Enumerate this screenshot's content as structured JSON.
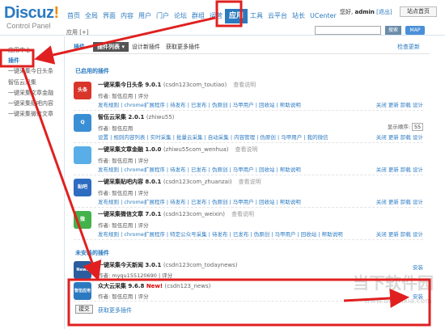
{
  "header": {
    "logo_main": "Discuz",
    "logo_exclaim": "!",
    "logo_sub": "Control Panel",
    "nav": [
      "首页",
      "全局",
      "界面",
      "内容",
      "用户",
      "门户",
      "论坛",
      "群组",
      "运营",
      "应用",
      "工具",
      "云平台",
      "站长",
      "UCenter"
    ],
    "nav_active": "应用",
    "user_greeting": "您好,",
    "user_name": "admin",
    "logout": "[退出]",
    "site_home": "站点首页",
    "breadcrumb": "应用 [+]",
    "search_button": "搜索",
    "map_button": "MAP"
  },
  "sidebar": {
    "items": [
      {
        "label": "应用中心",
        "current": false
      },
      {
        "label": "插件",
        "current": true
      },
      {
        "label": "一键采集今日头条",
        "current": false
      },
      {
        "label": "智伍云采集",
        "current": false
      },
      {
        "label": "一键采集文章金融",
        "current": false
      },
      {
        "label": "一键采集贴吧内容",
        "current": false
      },
      {
        "label": "一键采集微信文章",
        "current": false
      }
    ]
  },
  "tabs": {
    "plugin": "插件",
    "list": "插件列表",
    "design": "设计新插件",
    "get_more": "获取更多插件",
    "check_update": "检查更新"
  },
  "enabled_title": "已启用的插件",
  "plugins": [
    {
      "name": "一键采集今日头条 9.0.1",
      "id": "(csdn123com_toutiao)",
      "desc": "查看说明",
      "author": "作者: 智伍应用 | 评分",
      "links": "发布规则 | chrome扩展程序 | 待发布 | 已发布 | 伪原创 | 马甲用户 | 回收站 | 帮助说明",
      "actions": "关闭 更新 卸载 设计",
      "icon_color": "#d9352b",
      "icon_text": "头条"
    },
    {
      "name": "智伍云采集 2.0.1",
      "id": "(zhiwu55)",
      "desc": "",
      "author": "作者: 智伍应用",
      "links": "设置 | 规则内容列表 | 实时采集 | 批量云采集 | 自动采集 | 内容管理 | 伪原创 | 马甲用户 | 我的微信",
      "actions": "关闭 更新 卸载 设计",
      "order_label": "显示顺序:",
      "order_value": "55",
      "icon_color": "#3a8fd4",
      "icon_text": "Q"
    },
    {
      "name": "一键采集文章金融 1.0.0",
      "id": "(zhiwu55com_wenhua)",
      "desc": "查看说明",
      "author": "作者: 智伍应用 | 评分",
      "links": "发布规则 | chrome扩展程序 | 待发布 | 已发布 | 伪原创 | 马甲用户 | 回收站 | 帮助说明",
      "actions": "关闭 更新 卸载 设计",
      "icon_color": "#5aaee8",
      "icon_text": ""
    },
    {
      "name": "一键采集贴吧内容 8.0.1",
      "id": "(csdn123com_zhuanzai)",
      "desc": "查看说明",
      "author": "作者: 智伍应用 | 评分",
      "links": "发布规则 | chrome扩展程序 | 待发布 | 已发布 | 伪原创 | 马甲用户 | 回收站 | 帮助说明",
      "actions": "关闭 更新 卸载 设计",
      "icon_color": "#2d6cc0",
      "icon_text": "贴吧"
    },
    {
      "name": "一键采集微信文章 7.0.1",
      "id": "(csdn123com_weixin)",
      "desc": "查看说明",
      "author": "作者: 智伍应用 | 评分",
      "links": "发布规则 | chrome扩展程序 | 特定公众号采集 | 待发布 | 已发布 | 伪原创 | 马甲用户 | 回收站 | 帮助说明",
      "actions": "关闭 更新 卸载 设计",
      "icon_color": "#43b24a",
      "icon_text": "微"
    }
  ],
  "uninstalled_title": "未安装的插件",
  "uninstalled": [
    {
      "name": "一键采集今天新闻 3.0.1",
      "id": "(csdn123com_todaynews)",
      "author": "作者: myqu155120690 | 评分",
      "action": "安装",
      "icon_color": "#2b5c9e",
      "icon_text": "News"
    },
    {
      "name": "众大云采集 9.6.8",
      "new": "New!",
      "id": "(csdn123_news)",
      "author": "作者: 智伍应用 | 评分",
      "action": "安装",
      "icon_color": "#2b7ac0",
      "icon_text": "智伍应用"
    }
  ],
  "footer": {
    "submit": "提交",
    "get_more": "获取更多插件"
  },
  "watermark": {
    "cn": "当下软件园",
    "url": "www.downxia.com"
  },
  "annotation_color": "#e02020"
}
